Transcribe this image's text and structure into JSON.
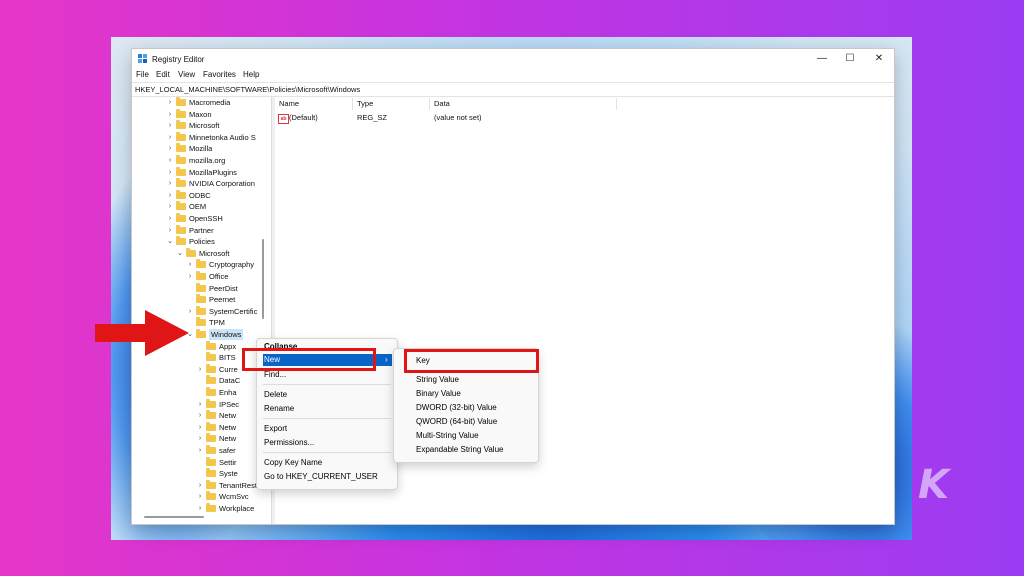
{
  "window": {
    "title": "Registry Editor",
    "minimize": "—",
    "maximize": "☐",
    "close": "✕"
  },
  "menubar": [
    "File",
    "Edit",
    "View",
    "Favorites",
    "Help"
  ],
  "address": "HKEY_LOCAL_MACHINE\\SOFTWARE\\Policies\\Microsoft\\Windows",
  "tree": [
    {
      "label": "Macromedia",
      "chev": "›"
    },
    {
      "label": "Maxon",
      "chev": "›"
    },
    {
      "label": "Microsoft",
      "chev": "›"
    },
    {
      "label": "Minnetonka Audio S",
      "chev": "›"
    },
    {
      "label": "Mozilla",
      "chev": "›"
    },
    {
      "label": "mozilla.org",
      "chev": "›"
    },
    {
      "label": "MozillaPlugins",
      "chev": "›"
    },
    {
      "label": "NVIDIA Corporation",
      "chev": "›"
    },
    {
      "label": "ODBC",
      "chev": "›"
    },
    {
      "label": "OEM",
      "chev": "›"
    },
    {
      "label": "OpenSSH",
      "chev": "›"
    },
    {
      "label": "Partner",
      "chev": "›"
    },
    {
      "label": "Policies",
      "chev": "⌄"
    },
    {
      "label": "Microsoft",
      "chev": "⌄"
    },
    {
      "label": "Cryptography",
      "chev": "›"
    },
    {
      "label": "Office",
      "chev": "›"
    },
    {
      "label": "PeerDist",
      "chev": ""
    },
    {
      "label": "Peernet",
      "chev": ""
    },
    {
      "label": "SystemCertific",
      "chev": "›"
    },
    {
      "label": "TPM",
      "chev": ""
    },
    {
      "label": "Windows",
      "chev": "⌄"
    },
    {
      "label": "Appx",
      "chev": ""
    },
    {
      "label": "BITS",
      "chev": ""
    },
    {
      "label": "Curre",
      "chev": "›"
    },
    {
      "label": "DataC",
      "chev": ""
    },
    {
      "label": "Enha",
      "chev": ""
    },
    {
      "label": "IPSec",
      "chev": "›"
    },
    {
      "label": "Netw",
      "chev": "›"
    },
    {
      "label": "Netw",
      "chev": "›"
    },
    {
      "label": "Netw",
      "chev": "›"
    },
    {
      "label": "safer",
      "chev": "›"
    },
    {
      "label": "Settir",
      "chev": ""
    },
    {
      "label": "Syste",
      "chev": ""
    },
    {
      "label": "TenantRest",
      "chev": "›"
    },
    {
      "label": "WcmSvc",
      "chev": "›"
    },
    {
      "label": "Workplace",
      "chev": "›"
    }
  ],
  "columns": {
    "name": "Name",
    "type": "Type",
    "data": "Data"
  },
  "values": [
    {
      "name": "(Default)",
      "type": "REG_SZ",
      "data": "(value not set)",
      "icon": "ab"
    }
  ],
  "context_menu": {
    "collapse": "Collapse",
    "new": "New",
    "find": "Find...",
    "delete": "Delete",
    "rename": "Rename",
    "export": "Export",
    "permissions": "Permissions...",
    "copy_key_name": "Copy Key Name",
    "goto_hkcu": "Go to HKEY_CURRENT_USER"
  },
  "submenu": {
    "key": "Key",
    "string_value": "String Value",
    "binary_value": "Binary Value",
    "dword": "DWORD (32-bit) Value",
    "qword": "QWORD (64-bit) Value",
    "multi_string": "Multi-String Value",
    "expandable_string": "Expandable String Value"
  },
  "brand_mark": "K",
  "colors": {
    "highlight": "#0a64c8",
    "annotation": "#e01515",
    "folder": "#f3c64c"
  }
}
